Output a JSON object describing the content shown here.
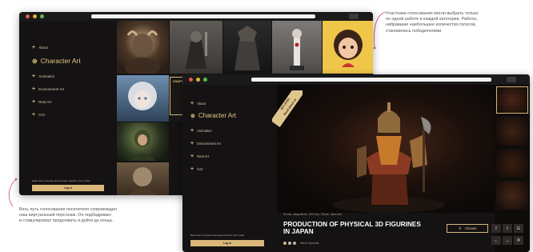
{
  "annotations": {
    "top_right": [
      "Участники голосования могли выбрать только",
      "по одной работе в каждой категории. Работы,",
      "набравшие наибольшее количество голосов,",
      "становились победителями."
    ],
    "bottom_left": [
      "Весь путь голосования посетителя сопровождал",
      "наш виртуальный персонаж. Он подбадривал",
      "и стимулировал продолжить и дойти до конца."
    ]
  },
  "sidebar": {
    "items": [
      {
        "label": "About"
      },
      {
        "label": "Character Art",
        "active": true
      },
      {
        "label": "Animation"
      },
      {
        "label": "Environment Art"
      },
      {
        "label": "Real Art"
      },
      {
        "label": "CGI"
      }
    ],
    "deadline": "Make Vote in Animate, Environment, Real Art, CGI in Artist",
    "signin_label": "Log in"
  },
  "back_window": {
    "badge": "CHAPTERS & CASTLES",
    "characters": [
      "minotaur-render",
      "knight-render",
      "dark-armor-render",
      "samurai-render",
      "cartoon-girl-render",
      "doll-render",
      "archer-render",
      "witch-render"
    ]
  },
  "front_window": {
    "ribbon": [
      "NO LEVEL",
      "Read about us"
    ],
    "caption_small": "Render, Allegorithmic, 3DS Max, ZBrush, Marmoset",
    "title_line1": "PRODUCTION OF PHYSICAL 3D FIGURINES",
    "title_line2": "IN JAPAN",
    "author": "Maxim Zlyonmal",
    "choose_label": "Choose",
    "social": [
      "f",
      "t",
      "G"
    ],
    "nav": [
      "←",
      "→",
      "✕"
    ]
  },
  "colors": {
    "gold": "#d9b87a",
    "dark": "#141212",
    "annotation_curve": "#d94a6a"
  }
}
